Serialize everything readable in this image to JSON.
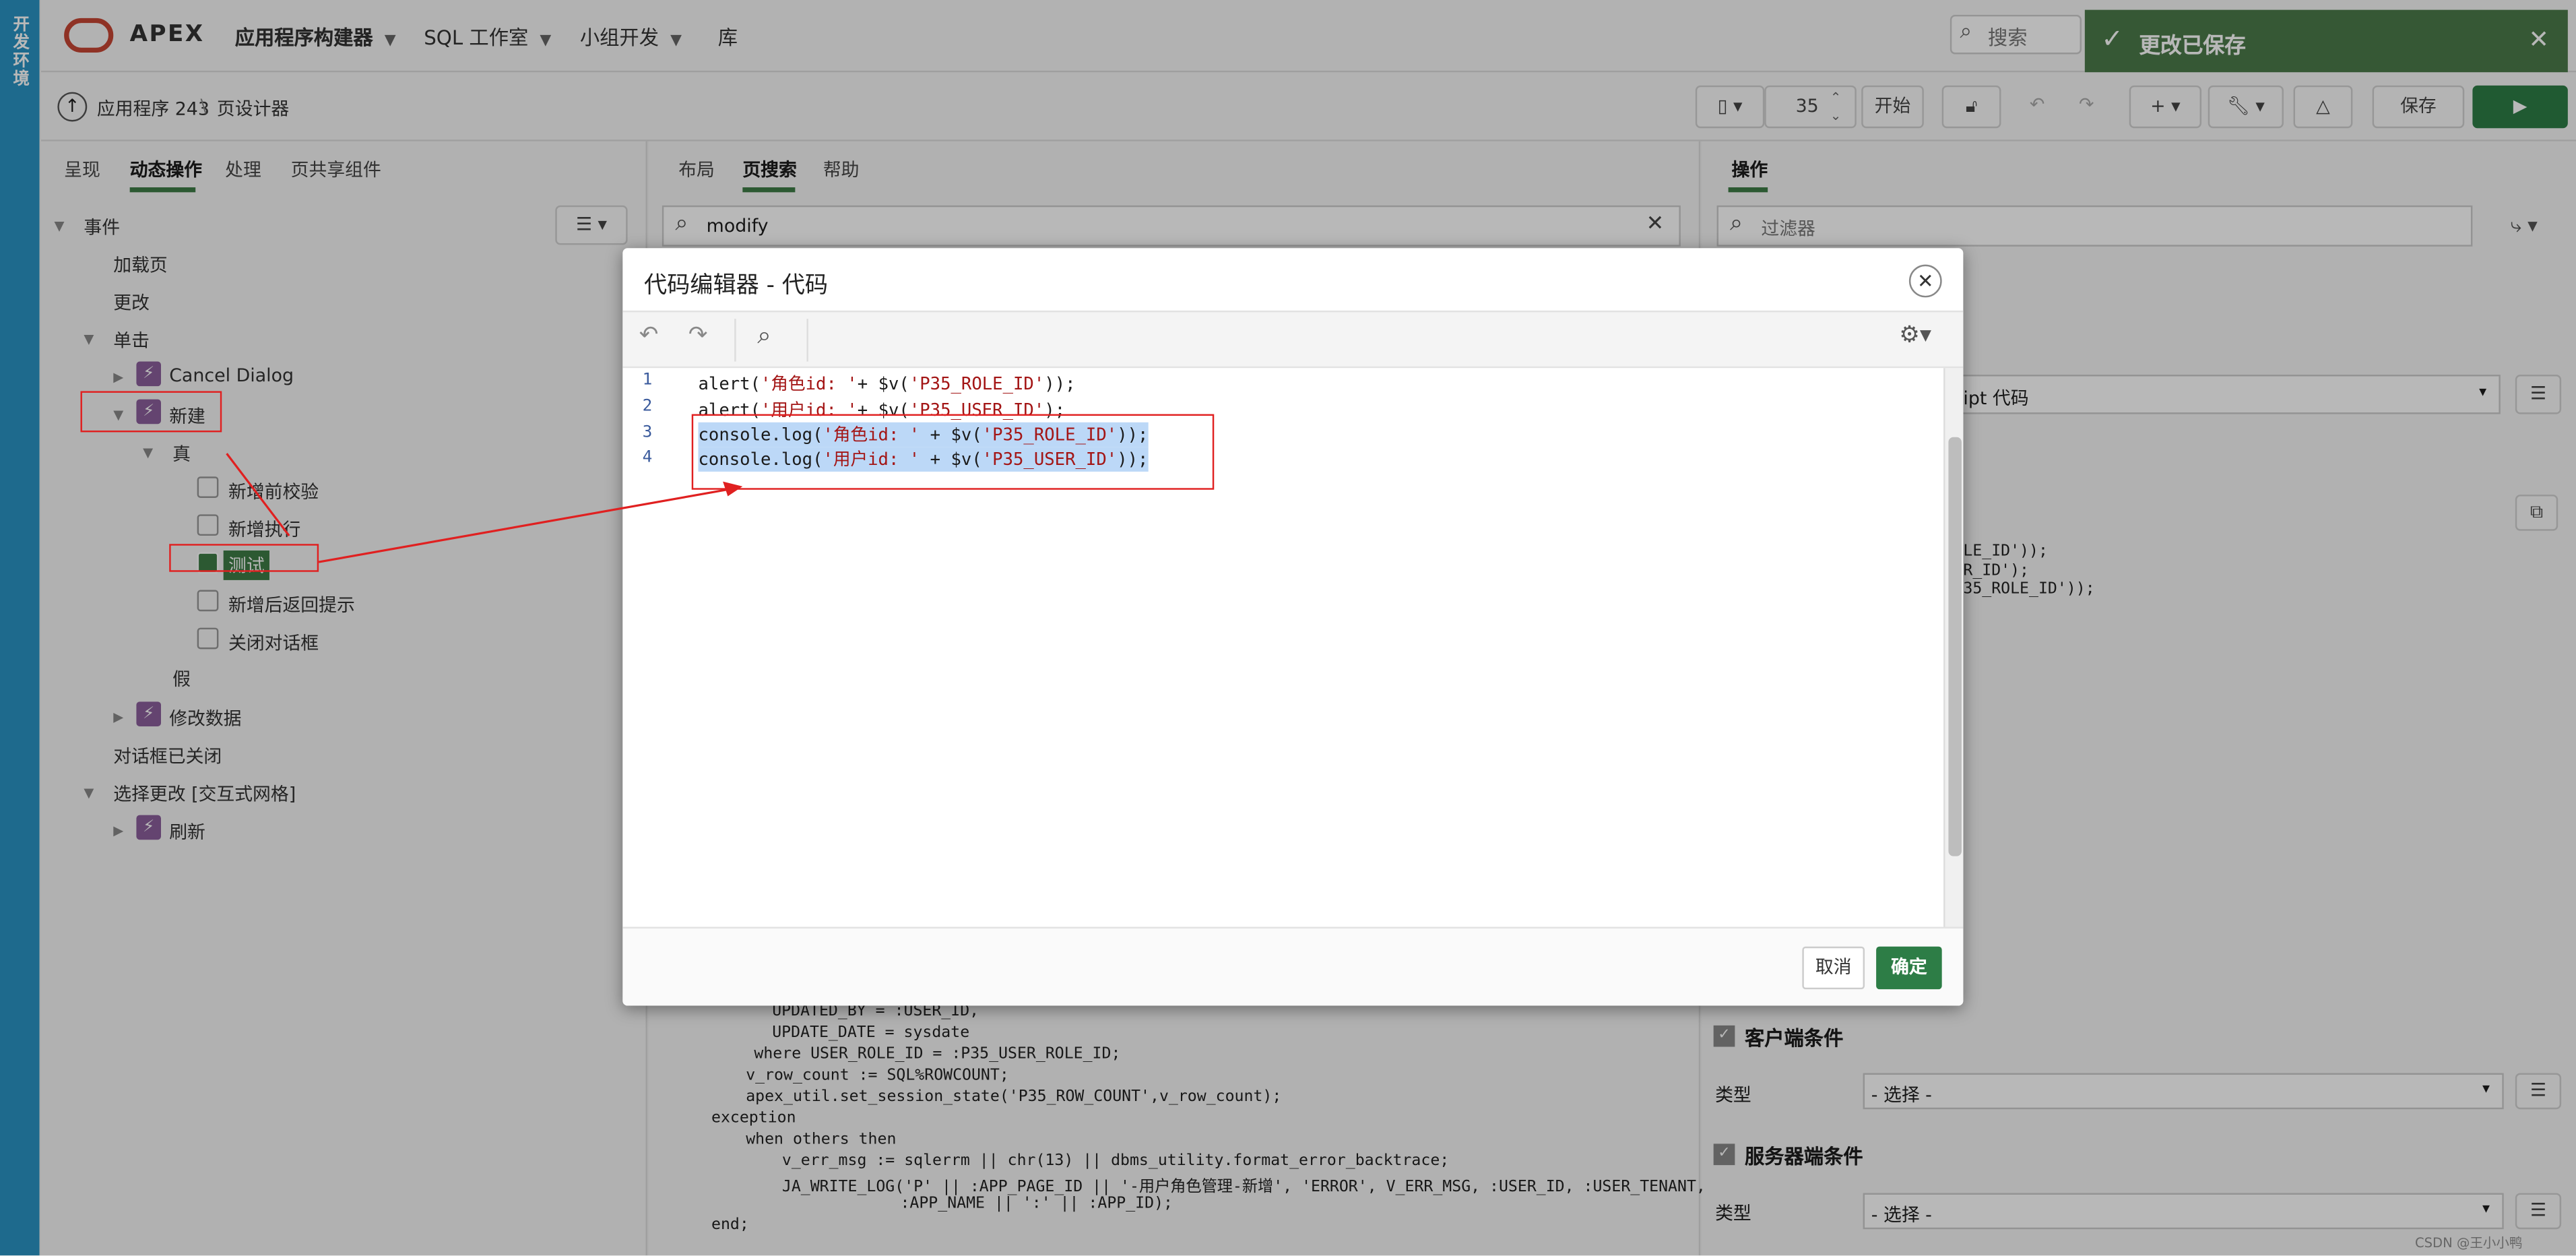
{
  "env": {
    "label": "开发环境"
  },
  "topbar": {
    "brand": "APEX",
    "nav": [
      "应用程序构建器",
      "SQL 工作室",
      "小组开发",
      "库"
    ],
    "search_placeholder": "搜索",
    "toast": "更改已保存"
  },
  "subbar": {
    "breadcrumb_app": "应用程序 243",
    "breadcrumb_page": "页设计器",
    "page_number": "35",
    "start_label": "开始",
    "save_label": "保存"
  },
  "left_panel": {
    "tabs": [
      "呈现",
      "动态操作",
      "处理",
      "页共享组件"
    ],
    "tree": {
      "events": "事件",
      "page_load": "加载页",
      "change": "更改",
      "click": "单击",
      "cancel_dialog": "Cancel Dialog",
      "new": "新建",
      "true_branch": "真",
      "actions": [
        "新增前校验",
        "新增执行",
        "测试",
        "新增后返回提示",
        "关闭对话框"
      ],
      "false_branch": "假",
      "modify_data": "修改数据",
      "dialog_closed": "对话框已关闭",
      "selection_change": "选择更改 [交互式网格]",
      "refresh": "刷新"
    }
  },
  "middle_panel": {
    "tabs": [
      "布局",
      "页搜索",
      "帮助"
    ],
    "search_value": "modify",
    "code_lines": [
      "UPDATED_BY = :USER_ID,",
      "UPDATE_DATE = sysdate",
      "where USER_ROLE_ID = :P35_USER_ROLE_ID;",
      "v_row_count := SQL%ROWCOUNT;",
      "apex_util.set_session_state('P35_ROW_COUNT',v_row_count);",
      "exception",
      "when others then",
      "v_err_msg := sqlerrm || chr(13) || dbms_utility.format_error_backtrace;",
      "JA_WRITE_LOG('P' || :APP_PAGE_ID || '-用户角色管理-新增', 'ERROR', V_ERR_MSG, :USER_ID, :USER_TENANT,",
      ":APP_NAME || ':' || :APP_ID);",
      "end;"
    ]
  },
  "right_panel": {
    "tab": "操作",
    "filter_placeholder": "过滤器",
    "action_select": "ipt 代码",
    "code_snippets": [
      "LE_ID'));",
      "R_ID');",
      "35_ROLE_ID'));"
    ],
    "client_condition": "客户端条件",
    "server_condition": "服务器端条件",
    "type_label": "类型",
    "select_placeholder": "- 选择 -"
  },
  "dialog": {
    "title": "代码编辑器 - 代码",
    "cancel_label": "取消",
    "ok_label": "确定",
    "lines": [
      {
        "num": "1",
        "a": "alert(",
        "s": "'角色id: '",
        "b": "+ $v(",
        "s2": "'P35_ROLE_ID'",
        "c": "));"
      },
      {
        "num": "2",
        "a": "alert(",
        "s": "'用户id: '",
        "b": "+ $v(",
        "s2": "'P35_USER_ID'",
        "c": ");"
      },
      {
        "num": "3",
        "a": "console.log(",
        "s": "'角色id: '",
        "b": " + $v(",
        "s2": "'P35_ROLE_ID'",
        "c": "));"
      },
      {
        "num": "4",
        "a": "console.log(",
        "s": "'用户id: '",
        "b": " + $v(",
        "s2": "'P35_USER_ID'",
        "c": "));"
      }
    ]
  },
  "watermark": "CSDN @王小小鸭",
  "colors": {
    "env": "#2a94c4",
    "brand": "#c74634",
    "primary": "#2d7d46",
    "annotation": "#e02020"
  }
}
